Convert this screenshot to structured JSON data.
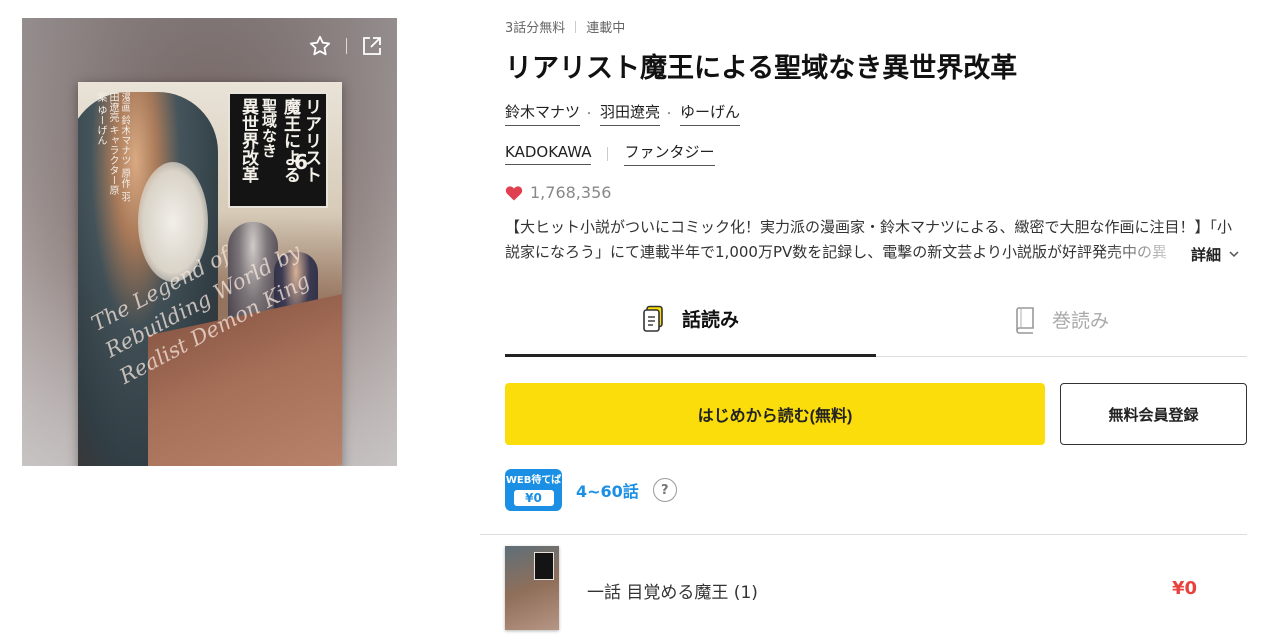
{
  "cover": {
    "title_lines": [
      "リアリスト",
      "魔王による",
      "聖域なき",
      "異世界改革"
    ],
    "volume": "6",
    "english_title": "The Legend of Rebuilding World by Realist Demon King",
    "credits": "漫画 鈴木マナツ 原作 羽田遼亮 キャラクター原案 ゆーげん",
    "actions": {
      "favorite_icon": "star-outline-icon",
      "share_icon": "external-link-icon"
    }
  },
  "meta": {
    "free_label": "3話分無料",
    "status_label": "連載中"
  },
  "title": "リアリスト魔王による聖域なき異世界改革",
  "authors": [
    "鈴木マナツ",
    "羽田遼亮",
    "ゆーげん"
  ],
  "author_separator": "・",
  "publisher": "KADOKAWA",
  "genre": "ファンタジー",
  "likes": "1,768,356",
  "description": "【大ヒット小説がついにコミック化！実力派の漫画家・鈴木マナツによる、緻密で大胆な作画に注目！】「小説家になろう」にて連載半年で1,000万PV数を記録し、電撃の新文芸より小説版が好評発売中の異",
  "more_label": "詳細",
  "tabs": [
    {
      "label": "話読み",
      "icon": "episode-icon",
      "active": true
    },
    {
      "label": "巻読み",
      "icon": "volume-book-icon",
      "active": false
    }
  ],
  "buttons": {
    "read_from_start": "はじめから読む(無料)",
    "register": "無料会員登録"
  },
  "webmate": {
    "badge_top": "WEB待てば",
    "badge_price": "¥0",
    "range": "4~60話",
    "help": "?"
  },
  "episodes": [
    {
      "title": "一話 目覚める魔王 (1)",
      "price": "¥0"
    }
  ],
  "colors": {
    "accent_yellow": "#fadd0a",
    "webmate_blue": "#1a8fe3",
    "price_red": "#e8423f",
    "heart": "#e04050"
  }
}
